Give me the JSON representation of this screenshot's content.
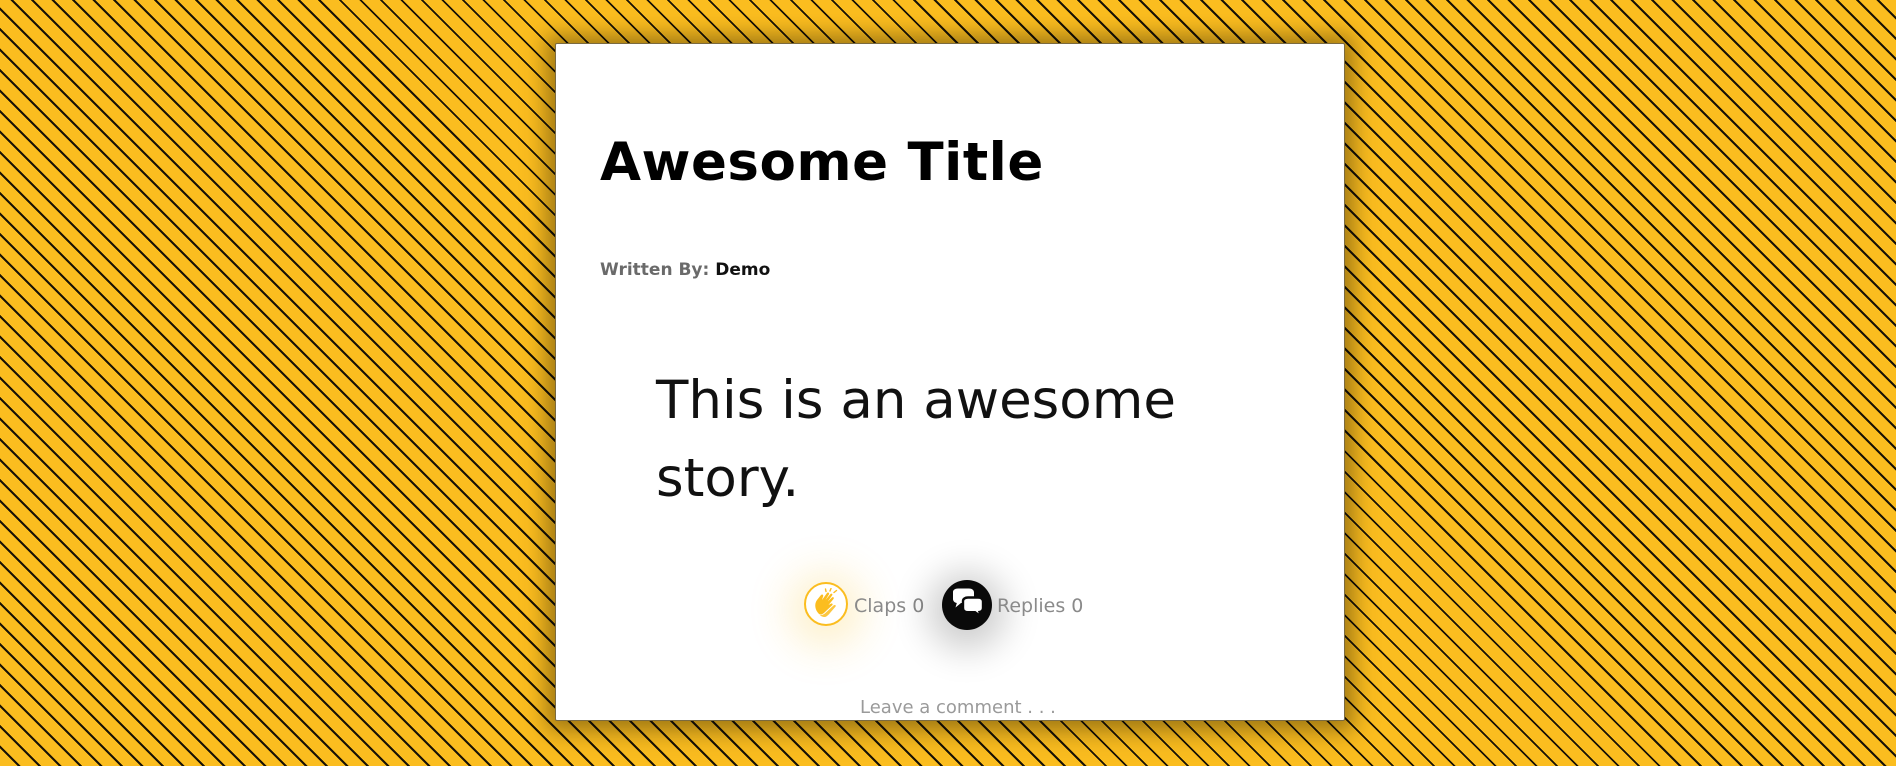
{
  "theme": {
    "background": "#fbbd1f",
    "stripe": "#1a1306",
    "card": "#ffffff",
    "accent": "#fbbd1f"
  },
  "post": {
    "title": "Awesome Title",
    "byline_label": "Written By:",
    "author": "Demo",
    "body": "This is an awesome story."
  },
  "actions": {
    "clap_icon": "clap-hands-icon",
    "clap_label": "Claps 0",
    "reply_icon": "speech-bubbles-icon",
    "reply_label": "Replies 0",
    "comment_link": "Leave a comment . . ."
  }
}
